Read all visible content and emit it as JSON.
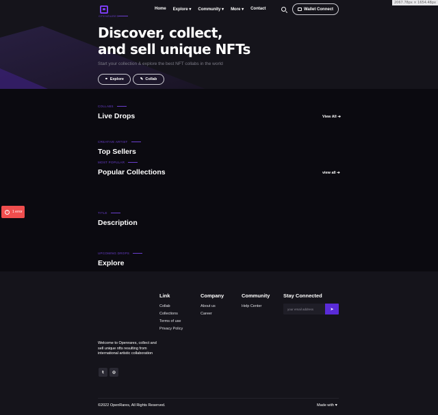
{
  "viewport_badge": "2067.78px × 1654.48px",
  "brand": {
    "name": "OPENRARES"
  },
  "nav": {
    "items": [
      "Home",
      "Explore",
      "Community",
      "More",
      "Contact"
    ],
    "wallet_label": "Wallet Connect"
  },
  "hero": {
    "title_line1": "Discover, collect,",
    "title_line2": "and sell unique NFTs",
    "subtitle": "Start your collection & explore the best NFT collabs in the world",
    "explore_label": "Explore",
    "collab_label": "Collab"
  },
  "sections": {
    "live_drops": {
      "label": "COLLABS",
      "title": "Live Drops",
      "view_all": "View All"
    },
    "top_sellers": {
      "label": "CREATIVE ARTIST",
      "title": "Top Sellers"
    },
    "popular": {
      "label": "MOST POPULAR",
      "title": "Popular Collections",
      "view_all": "view all"
    },
    "description": {
      "label": "TITLE",
      "title": "Description"
    },
    "explore": {
      "label": "UPCOMING DROPS",
      "title": "Explore"
    }
  },
  "error_badge": {
    "label": "1 error"
  },
  "footer": {
    "link_title": "Link",
    "links": [
      "Collab",
      "Collections",
      "Terms of use",
      "Privacy Policy"
    ],
    "company_title": "Company",
    "company_links": [
      "About us",
      "Career"
    ],
    "community_title": "Community",
    "community_links": [
      "Help Center"
    ],
    "stay_title": "Stay Connected",
    "email_placeholder": "your email address",
    "about": "Welcome to Openrares, collect and sell unique nfts resulting from international artistic collaboration",
    "copyright": "©2022 OpenRares, All Rights Reserved.",
    "made_with": "Made with"
  },
  "colors": {
    "accent": "#6b3fd0",
    "error": "#ef4e4e",
    "background": "#0b0a10",
    "panel": "#15141b"
  },
  "icons": [
    "search-icon",
    "wallet-icon",
    "link-icon",
    "edit-icon",
    "arrow-right-icon",
    "send-icon",
    "twitter-icon",
    "instagram-icon",
    "heart-icon",
    "error-icon",
    "chevron-down-icon"
  ]
}
